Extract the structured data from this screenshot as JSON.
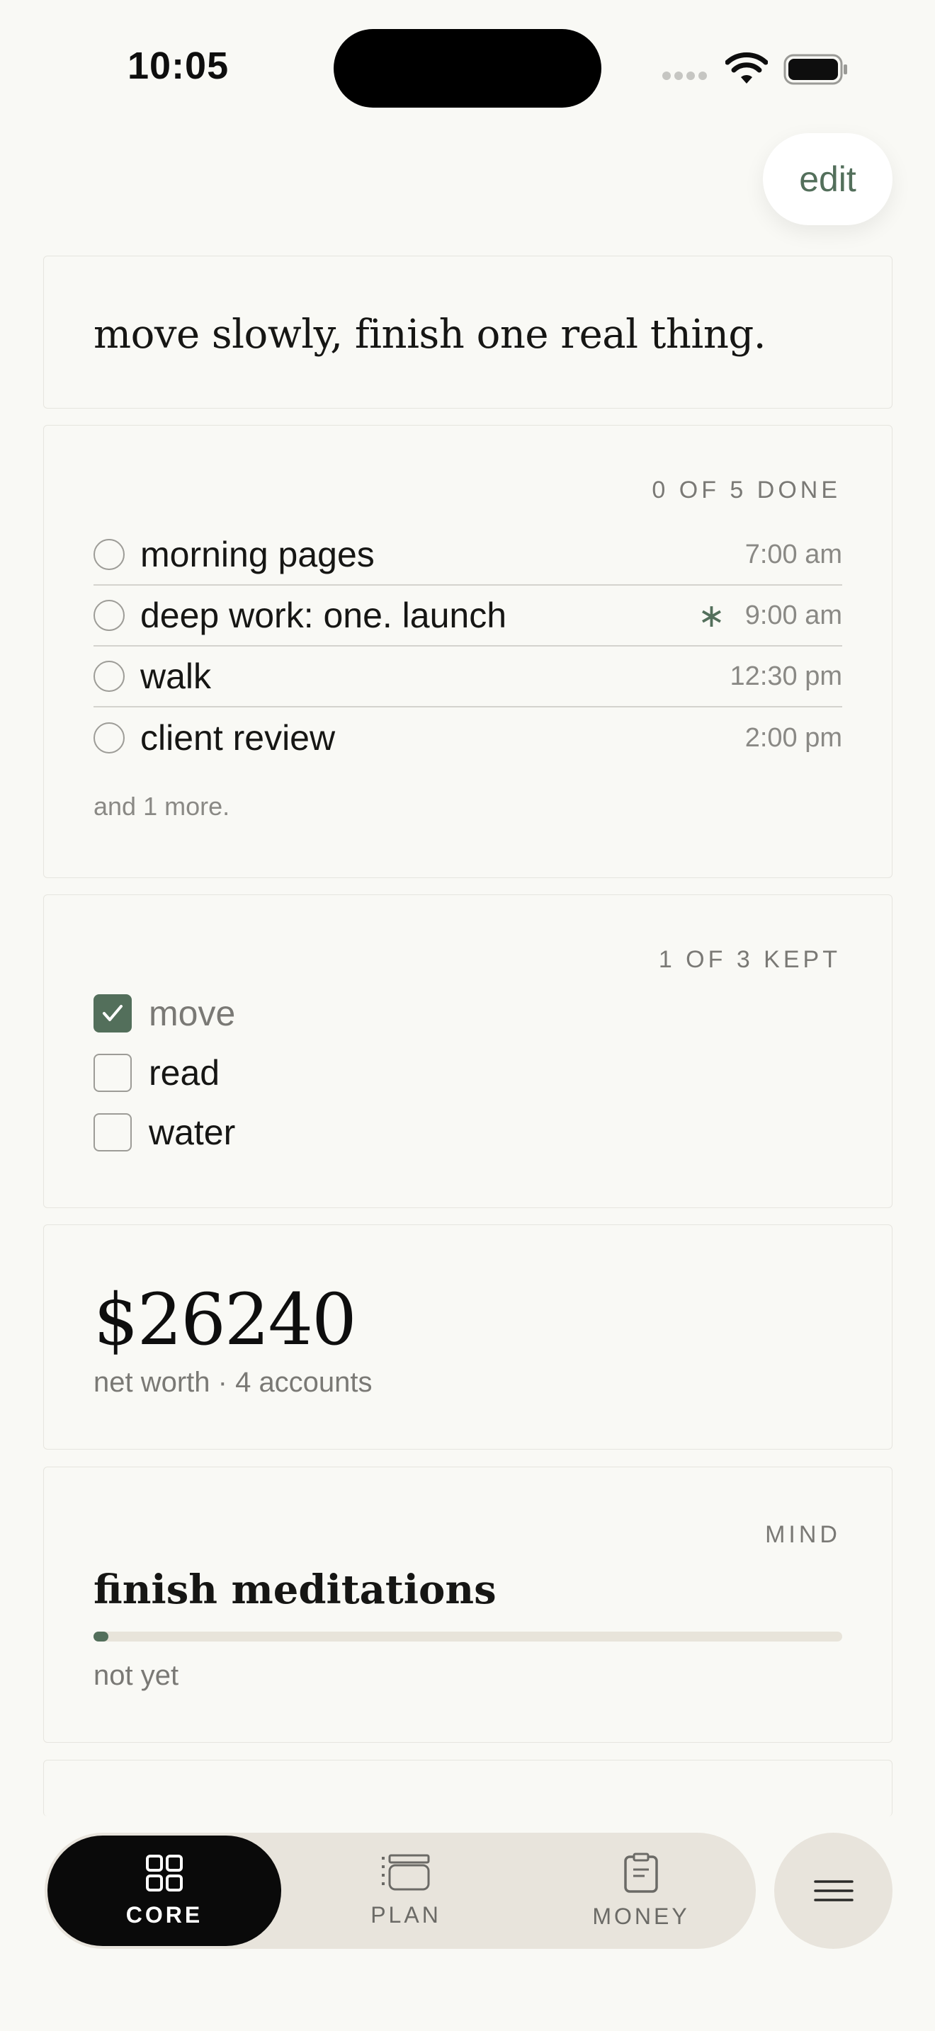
{
  "status_bar": {
    "time": "10:05"
  },
  "edit_button": {
    "label": "edit"
  },
  "intention": {
    "text": "move slowly, finish one real thing."
  },
  "tasks": {
    "summary": "0 OF 5 DONE",
    "items": [
      {
        "label": "morning pages",
        "time": "7:00 am",
        "starred": false
      },
      {
        "label": "deep work: one. launch",
        "time": "9:00 am",
        "starred": true,
        "star_glyph": "∗"
      },
      {
        "label": "walk",
        "time": "12:30 pm",
        "starred": false
      },
      {
        "label": "client review",
        "time": "2:00 pm",
        "starred": false
      }
    ],
    "more": "and 1 more."
  },
  "habits": {
    "summary": "1 OF 3 KEPT",
    "items": [
      {
        "label": "move",
        "checked": true
      },
      {
        "label": "read",
        "checked": false
      },
      {
        "label": "water",
        "checked": false
      }
    ]
  },
  "money": {
    "net_worth": "$26240",
    "subtitle": "net worth · 4 accounts"
  },
  "goal": {
    "category": "MIND",
    "title": "finish meditations",
    "progress_fraction": 0.02,
    "status": "not yet"
  },
  "nav": {
    "items": [
      {
        "label": "CORE",
        "icon": "grid-icon",
        "active": true
      },
      {
        "label": "PLAN",
        "icon": "plan-list-icon",
        "active": false
      },
      {
        "label": "MONEY",
        "icon": "clipboard-icon",
        "active": false
      }
    ],
    "menu_icon": "menu-icon"
  },
  "colors": {
    "background": "#f9f9f5",
    "accent": "#536f5b",
    "nav_active": "#0a0a0a",
    "nav_bg": "#e8e4dc"
  }
}
